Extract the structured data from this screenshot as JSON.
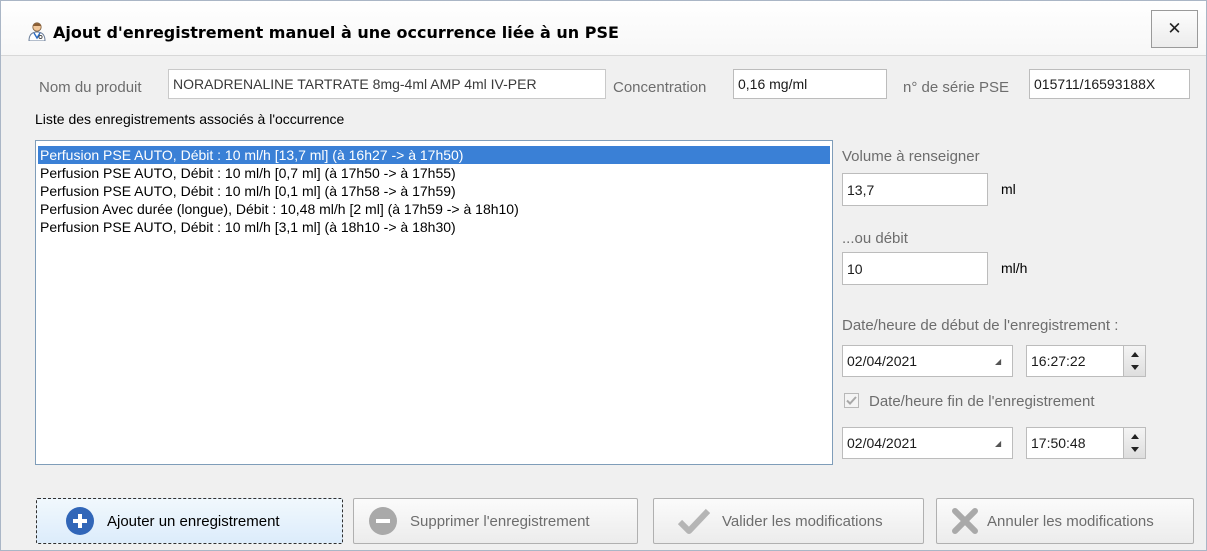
{
  "window": {
    "title": "Ajout d'enregistrement manuel à une occurrence liée à un PSE",
    "close_glyph": "✕",
    "icon": "doctor-icon"
  },
  "product": {
    "label": "Nom du produit",
    "value": "NORADRENALINE TARTRATE 8mg-4ml AMP 4ml IV-PER"
  },
  "concentration": {
    "label": "Concentration",
    "value": "0,16 mg/ml"
  },
  "serial": {
    "label": "n° de série PSE",
    "value": "015711/16593188X"
  },
  "list": {
    "label": "Liste des enregistrements associés à l'occurrence",
    "items": [
      "Perfusion PSE AUTO, Débit : 10 ml/h [13,7 ml] (à 16h27 -> à 17h50)",
      "Perfusion PSE AUTO, Débit : 10 ml/h [0,7 ml] (à 17h50 -> à 17h55)",
      "Perfusion PSE AUTO, Débit : 10 ml/h [0,1 ml] (à 17h58 -> à 17h59)",
      "Perfusion Avec durée (longue), Débit : 10,48 ml/h [2 ml] (à 17h59 -> à 18h10)",
      "Perfusion PSE AUTO, Débit : 10 ml/h [3,1 ml] (à 18h10 -> à 18h30)"
    ],
    "selected_index": 0
  },
  "volume": {
    "label": "Volume à renseigner",
    "value": "13,7",
    "unit": "ml"
  },
  "debit": {
    "label": "...ou débit",
    "value": "10",
    "unit": "ml/h"
  },
  "start": {
    "label": "Date/heure de début de l'enregistrement :",
    "date": "02/04/2021",
    "time": "16:27:22"
  },
  "end": {
    "checkbox_label": "Date/heure fin de l'enregistrement",
    "checked": true,
    "date": "02/04/2021",
    "time": "17:50:48"
  },
  "buttons": {
    "add": "Ajouter un enregistrement",
    "delete": "Supprimer l'enregistrement",
    "validate": "Valider les modifications",
    "cancel": "Annuler les modifications"
  },
  "colors": {
    "selection": "#3a80d6",
    "add_icon": "#3166b8",
    "disabled_icon": "#a9a9a9"
  }
}
